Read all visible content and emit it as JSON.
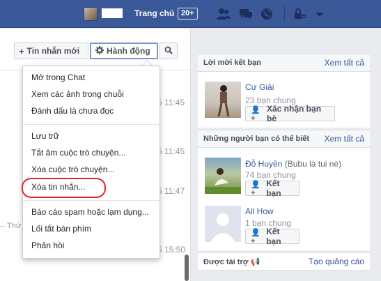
{
  "topbar": {
    "home_label": "Trang chủ",
    "home_count": "20+",
    "icons": [
      "friend-requests-icon",
      "messages-icon",
      "notifications-globe-icon",
      "privacy-lock-icon",
      "account-caret-icon"
    ]
  },
  "toolbar": {
    "new_message_label": "Tin nhắn mới",
    "actions_label": "Hành động",
    "search_icon": "search-icon"
  },
  "menu": {
    "items": [
      "Mở trong Chat",
      "Xem các ảnh trong chuỗi",
      "Đánh dấu là chưa đọc",
      "Lưu trữ",
      "Tắt âm cuộc trò chuyện...",
      "Xóa cuộc trò chuyện...",
      "Xóa tin nhắn...",
      "Báo cáo spam hoặc lạm dụng...",
      "Lối tắt bàn phím",
      "Phản hồi"
    ]
  },
  "conversation": {
    "times": [
      "5 11:45",
      "5 11:45",
      "5 11:47",
      "5 15:50"
    ],
    "day_label": "Thứ"
  },
  "friend_requests": {
    "title": "Lời mời kết bạn",
    "see_all": "Xem tất cả",
    "people": [
      {
        "name": "Cự Giải",
        "mutual": "23 bạn chung",
        "button": "Xác nhận bạn bè"
      }
    ]
  },
  "people_you_may_know": {
    "title": "Những người bạn có thể biết",
    "see_all": "Xem tất cả",
    "people": [
      {
        "name": "Đỗ Huyền",
        "note": "(Bubu là tui nè)",
        "mutual": "74 bạn chung",
        "button": "Kết bạn"
      },
      {
        "name": "All How",
        "note": "",
        "mutual": "1 bạn chung",
        "button": "Kết bạn"
      }
    ]
  },
  "sponsored": {
    "title": "Được tài trợ",
    "create_ad": "Tạo quảng cáo"
  },
  "colors": {
    "brand_blue": "#3b5998",
    "link_blue": "#365899",
    "highlight_red": "#d9262a"
  }
}
